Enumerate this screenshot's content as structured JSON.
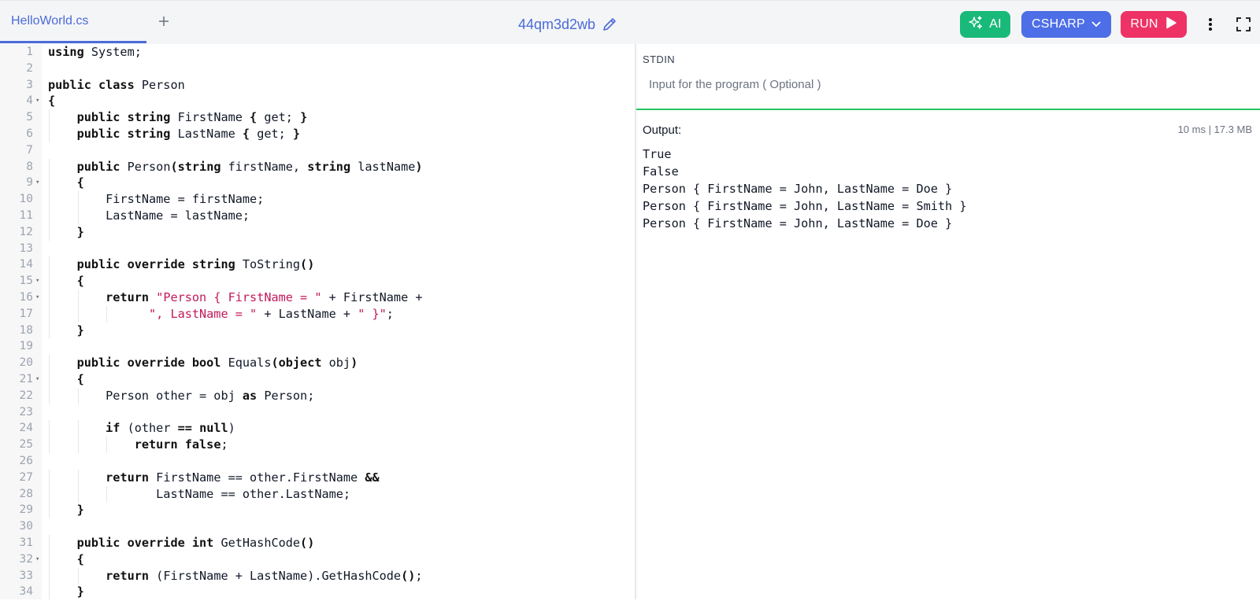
{
  "header": {
    "tab_label": "HelloWorld.cs",
    "add_tab_icon": "plus-icon",
    "title": "44qm3d2wb",
    "edit_icon": "pencil-icon",
    "ai_label": "AI",
    "language_label": "CSHARP",
    "run_label": "RUN",
    "colors": {
      "ai": "#19b97a",
      "language": "#4d6ee6",
      "run": "#ee3265",
      "accent": "#4b6bd8"
    }
  },
  "editor": {
    "folds": [
      4,
      9,
      15,
      16,
      21,
      32
    ],
    "lines": [
      [
        [
          "using",
          "kw"
        ],
        [
          " System;",
          ""
        ]
      ],
      [],
      [
        [
          "public class",
          "kw"
        ],
        [
          " Person",
          ""
        ]
      ],
      [
        [
          "{",
          "kw"
        ]
      ],
      [
        [
          "    ",
          ""
        ],
        [
          "public string",
          "kw"
        ],
        [
          " FirstName ",
          ""
        ],
        [
          "{",
          "kw"
        ],
        [
          " get; ",
          ""
        ],
        [
          "}",
          "kw"
        ]
      ],
      [
        [
          "    ",
          ""
        ],
        [
          "public string",
          "kw"
        ],
        [
          " LastName ",
          ""
        ],
        [
          "{",
          "kw"
        ],
        [
          " get; ",
          ""
        ],
        [
          "}",
          "kw"
        ]
      ],
      [],
      [
        [
          "    ",
          ""
        ],
        [
          "public",
          "kw"
        ],
        [
          " Person",
          ""
        ],
        [
          "(",
          "kw"
        ],
        [
          "string",
          "kw"
        ],
        [
          " firstName, ",
          ""
        ],
        [
          "string",
          "kw"
        ],
        [
          " lastName",
          ""
        ],
        [
          ")",
          "kw"
        ]
      ],
      [
        [
          "    ",
          ""
        ],
        [
          "{",
          "kw"
        ]
      ],
      [
        [
          "        FirstName = firstName;",
          ""
        ]
      ],
      [
        [
          "        LastName = lastName;",
          ""
        ]
      ],
      [
        [
          "    ",
          ""
        ],
        [
          "}",
          "kw"
        ]
      ],
      [],
      [
        [
          "    ",
          ""
        ],
        [
          "public override string",
          "kw"
        ],
        [
          " ToString",
          ""
        ],
        [
          "()",
          "kw"
        ]
      ],
      [
        [
          "    ",
          ""
        ],
        [
          "{",
          "kw"
        ]
      ],
      [
        [
          "        ",
          ""
        ],
        [
          "return",
          "kw"
        ],
        [
          " ",
          ""
        ],
        [
          "\"Person { FirstName = \"",
          "str"
        ],
        [
          " + FirstName +",
          ""
        ]
      ],
      [
        [
          "              ",
          ""
        ],
        [
          "\", LastName = \"",
          "str"
        ],
        [
          " + LastName + ",
          ""
        ],
        [
          "\" }\"",
          "str"
        ],
        [
          ";",
          ""
        ]
      ],
      [
        [
          "    ",
          ""
        ],
        [
          "}",
          "kw"
        ]
      ],
      [],
      [
        [
          "    ",
          ""
        ],
        [
          "public override bool",
          "kw"
        ],
        [
          " Equals",
          ""
        ],
        [
          "(",
          "kw"
        ],
        [
          "object",
          "kw"
        ],
        [
          " obj",
          ""
        ],
        [
          ")",
          "kw"
        ]
      ],
      [
        [
          "    ",
          ""
        ],
        [
          "{",
          "kw"
        ]
      ],
      [
        [
          "        Person other = obj ",
          ""
        ],
        [
          "as",
          "kw"
        ],
        [
          " Person;",
          ""
        ]
      ],
      [],
      [
        [
          "        ",
          ""
        ],
        [
          "if",
          "kw"
        ],
        [
          " (other ",
          ""
        ],
        [
          "==",
          "kw"
        ],
        [
          " ",
          ""
        ],
        [
          "null",
          "kw"
        ],
        [
          ")",
          ""
        ]
      ],
      [
        [
          "            ",
          ""
        ],
        [
          "return false",
          "kw"
        ],
        [
          ";",
          ""
        ]
      ],
      [],
      [
        [
          "        ",
          ""
        ],
        [
          "return",
          "kw"
        ],
        [
          " FirstName == other.FirstName ",
          ""
        ],
        [
          "&&",
          "kw"
        ]
      ],
      [
        [
          "               LastName == other.LastName;",
          ""
        ]
      ],
      [
        [
          "    ",
          ""
        ],
        [
          "}",
          "kw"
        ]
      ],
      [],
      [
        [
          "    ",
          ""
        ],
        [
          "public override int",
          "kw"
        ],
        [
          " GetHashCode",
          ""
        ],
        [
          "()",
          "kw"
        ]
      ],
      [
        [
          "    ",
          ""
        ],
        [
          "{",
          "kw"
        ]
      ],
      [
        [
          "        ",
          ""
        ],
        [
          "return",
          "kw"
        ],
        [
          " (FirstName + LastName).GetHashCode",
          ""
        ],
        [
          "()",
          "kw"
        ],
        [
          ";",
          ""
        ]
      ],
      [
        [
          "    ",
          ""
        ],
        [
          "}",
          "kw"
        ]
      ]
    ]
  },
  "stdin": {
    "label": "STDIN",
    "placeholder": "Input for the program ( Optional )"
  },
  "output": {
    "label": "Output:",
    "stats": "10 ms | 17.3 MB",
    "lines": [
      "True",
      "False",
      "Person { FirstName = John, LastName = Doe }",
      "Person { FirstName = John, LastName = Smith }",
      "Person { FirstName = John, LastName = Doe }"
    ]
  }
}
